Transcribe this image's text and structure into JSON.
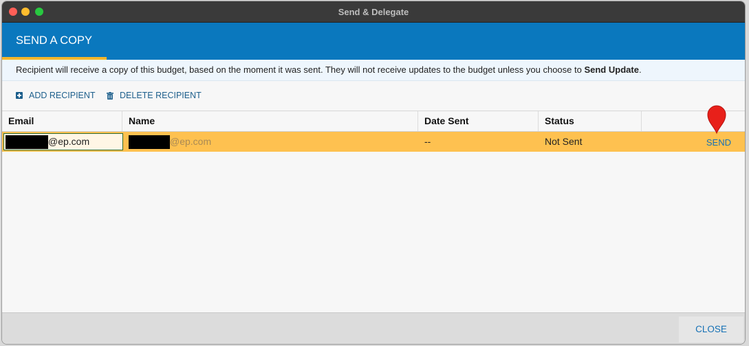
{
  "window": {
    "title": "Send & Delegate"
  },
  "header": {
    "tab_label": "SEND A COPY",
    "accent_color": "#f3b62b",
    "bar_color": "#0a78be"
  },
  "info": {
    "text_before": "Recipient will receive a copy of this budget, based on the moment it was sent. They will not receive updates to the budget unless you choose to ",
    "bold_text": "Send Update",
    "text_after": "."
  },
  "toolbar": {
    "add_label": "ADD RECIPIENT",
    "add_icon": "plus-square-icon",
    "delete_label": "DELETE RECIPIENT",
    "delete_icon": "trash-icon"
  },
  "table": {
    "columns": [
      "Email",
      "Name",
      "Date Sent",
      "Status",
      ""
    ],
    "rows": [
      {
        "email": "@ep.com",
        "name": "@ep.com",
        "date_sent": "--",
        "status": "Not Sent",
        "action": "SEND"
      }
    ],
    "selected_row_color": "#fec150"
  },
  "footer": {
    "close_label": "CLOSE"
  }
}
